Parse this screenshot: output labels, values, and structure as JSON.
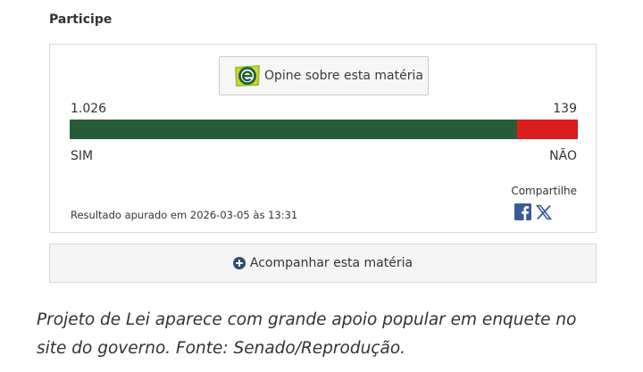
{
  "section": {
    "title": "Participe"
  },
  "poll": {
    "opine_label": "Opine sobre esta matéria",
    "yes_count": "1.026",
    "no_count": "139",
    "yes_value": 1026,
    "no_value": 139,
    "yes_label": "SIM",
    "no_label": "NÃO",
    "yes_color": "#275a36",
    "no_color": "#dc1d1d",
    "result_text": "Resultado apurado em 2026-03-05 às 13:31"
  },
  "share": {
    "label": "Compartilhe",
    "icons": [
      "facebook-icon",
      "x-icon"
    ]
  },
  "follow": {
    "label": "Acompanhar esta matéria",
    "icon": "plus-circle-icon"
  },
  "caption": {
    "text": "Projeto de Lei aparece com grande apoio popular em enquete no site do governo. Fonte: Senado/Reprodução."
  }
}
